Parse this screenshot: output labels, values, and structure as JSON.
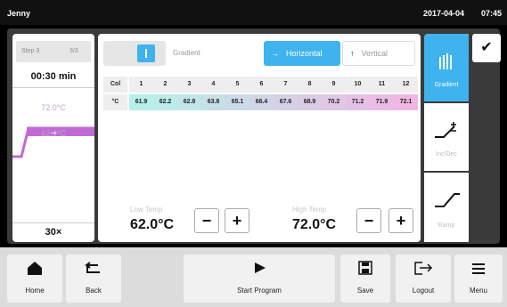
{
  "status_bar": {
    "user": "Jenny",
    "date": "2017-04-04",
    "time": "07:45"
  },
  "left_panel": {
    "step_label": "Step 3",
    "step_count": "3/3",
    "duration": "00:30 min",
    "temp_high": "72.0°C",
    "temp_low": "62.0°C",
    "cycles": "30×"
  },
  "gradient_panel": {
    "toggle_label": "Gradient",
    "horizontal_label": "Horizontal",
    "vertical_label": "Vertical",
    "row_headers": [
      "Col",
      "°C"
    ],
    "columns": [
      "1",
      "2",
      "3",
      "4",
      "5",
      "6",
      "7",
      "8",
      "9",
      "10",
      "11",
      "12"
    ],
    "temps": [
      "61.9",
      "62.2",
      "62.8",
      "63.8",
      "65.1",
      "66.4",
      "67.6",
      "68.9",
      "70.2",
      "71.2",
      "71.9",
      "72.1"
    ],
    "low_temp_label": "Low Temp",
    "low_temp_value": "62.0°C",
    "high_temp_label": "High Temp",
    "high_temp_value": "72.0°C",
    "minus": "−",
    "plus": "+"
  },
  "side_tabs": [
    {
      "label": "Gradient",
      "icon": "gradient-bars-icon",
      "active": true
    },
    {
      "label": "Inc/Dec",
      "icon": "inc-dec-icon",
      "active": false
    },
    {
      "label": "Ramp",
      "icon": "ramp-icon",
      "active": false
    }
  ],
  "confirm": {
    "icon": "checkmark-icon",
    "glyph": "✔"
  },
  "bottom_bar": {
    "home": "Home",
    "back": "Back",
    "start": "Start Program",
    "save": "Save",
    "logout": "Logout",
    "menu": "Menu"
  },
  "colors": {
    "accent": "#3fb3ee",
    "gradient_cool": "#b7f0ea",
    "gradient_warm": "#f0b7e4",
    "profile_line": "#c16ad6"
  }
}
